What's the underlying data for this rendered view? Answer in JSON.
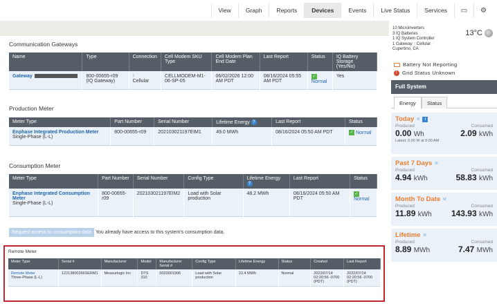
{
  "nav": {
    "tabs": [
      "View",
      "Graph",
      "Reports",
      "Devices",
      "Events",
      "Live Status",
      "Services"
    ],
    "active": "Devices",
    "icons": [
      "monitor-icon",
      "gear-icon"
    ]
  },
  "gateways": {
    "title": "Communication Gateways",
    "headers": [
      "Name",
      "Type",
      "Connection",
      "Cell Modem SKU Type",
      "Cell Modem Plan End Date",
      "Last Report",
      "Status",
      "IQ Battery Storage (Yes/No)"
    ],
    "row": {
      "name": "Gateway",
      "type": "800-00655-r09 (IQ Gateway)",
      "connection": "Cellular",
      "sku": "CELLMODEM-M1-06-SP-05",
      "plan_end": "06/02/2026 12:00 AM PDT",
      "last_report": "08/16/2024 05:55 AM PDT",
      "status": "Normal",
      "battery": "Yes"
    }
  },
  "production": {
    "title": "Production Meter",
    "headers": [
      "Meter Type",
      "Part Number",
      "Serial Number",
      "Lifetime Energy",
      "Last Report",
      "Status"
    ],
    "row": {
      "meter_type": "Enphase Integrated Production Meter",
      "phase": "Single-Phase (L-L)",
      "part": "800-00655-r09",
      "serial": "202103021197EIM1",
      "energy": "49.0 MWh",
      "last_report": "08/16/2024 05:50 AM PDT",
      "status": "Normal"
    }
  },
  "consumption": {
    "title": "Consumption Meter",
    "headers": [
      "Meter Type",
      "Part Number",
      "Serial Number",
      "Config Type",
      "Lifetime Energy",
      "Last Report",
      "Status"
    ],
    "row": {
      "meter_type": "Enphase Integrated Consumption Meter",
      "phase": "Single-Phase (L-L)",
      "part": "800-00655-r09",
      "serial": "202103021197EIM2",
      "config": "Load with Solar production",
      "energy": "48.2 MWh",
      "last_report": "08/16/2024 05:50 AM PDT",
      "status": "Normal"
    },
    "request_button": "Request access to consumption data",
    "access_text": "You already have access to this system's consumption data."
  },
  "remote": {
    "title": "Remote Meter",
    "headers": [
      "Meter Type",
      "Serial #",
      "Manufacturer",
      "Model",
      "Manufacturer Serial #",
      "Config Type",
      "Lifetime Energy",
      "Status",
      "Created",
      "Last Report"
    ],
    "row": {
      "meter_type": "Remote Meter",
      "phase": "Three-Phase (L-L)",
      "serial": "12213800266SERM1",
      "manufacturer": "Measurlogic Inc",
      "model": "DTS 310",
      "mfr_serial": "0020001906",
      "config": "Load with Solar production",
      "energy": "22.4 MWh",
      "status": "Normal",
      "created": "2022/07/14 02:20:56 -0700 (PDT)",
      "last_report": "2022/07/14 02:20:56 -0700 (PDT)"
    }
  },
  "sidebar": {
    "info_lines": [
      "10 Microinverters",
      "3 IQ Batteries",
      "1 IQ System Controller",
      "1 Gateway",
      "Cellular",
      "Cupertino, CA"
    ],
    "temperature": "13°C",
    "battery_status": "Battery Not Reporting",
    "grid_status": "Grid Status Unknown",
    "full_system": "Full System",
    "tabs": [
      "Energy",
      "Status"
    ],
    "produced_label": "Produced",
    "consumed_label": "Consumed",
    "today": {
      "title": "Today",
      "produced": "0.00",
      "produced_unit": "Wh",
      "consumed": "2.09",
      "consumed_unit": "kWh",
      "latest": "Latest: 0.00 W at 6:00 AM"
    },
    "past7": {
      "title": "Past 7 Days",
      "produced": "4.94",
      "produced_unit": "kWh",
      "consumed": "58.83",
      "consumed_unit": "kWh"
    },
    "month": {
      "title": "Month To Date",
      "produced": "11.89",
      "produced_unit": "kWh",
      "consumed": "143.93",
      "consumed_unit": "kWh"
    },
    "lifetime": {
      "title": "Lifetime",
      "produced": "8.89",
      "produced_unit": "MWh",
      "consumed": "7.47",
      "consumed_unit": "MWh"
    }
  }
}
